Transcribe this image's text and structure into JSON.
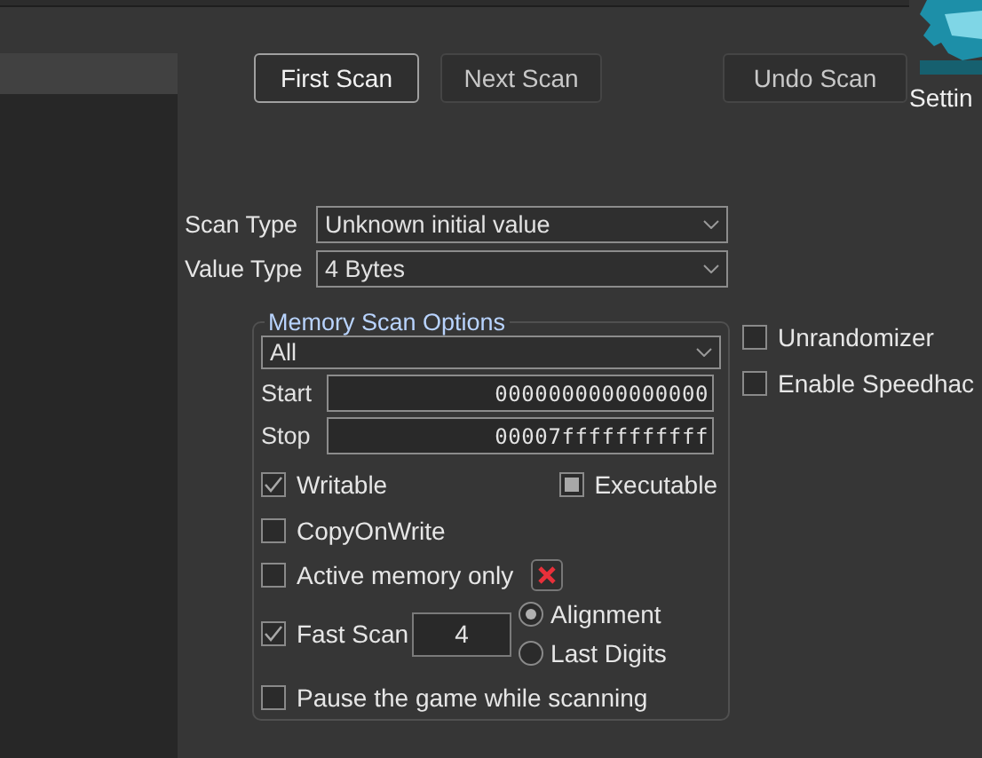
{
  "buttons": [
    {
      "label": "First Scan",
      "focused": true
    },
    {
      "label": "Next Scan",
      "focused": false
    },
    {
      "label": "Undo Scan",
      "focused": false
    }
  ],
  "settings_label": "Settin",
  "scan_type": {
    "label": "Scan Type",
    "value": "Unknown initial value"
  },
  "value_type": {
    "label": "Value Type",
    "value": "4 Bytes"
  },
  "memory_scan_options": {
    "title": "Memory Scan Options",
    "region": "All",
    "start": {
      "label": "Start",
      "value": "0000000000000000"
    },
    "stop": {
      "label": "Stop",
      "value": "00007fffffffffff"
    },
    "writable": {
      "label": "Writable",
      "checked": true
    },
    "executable": {
      "label": "Executable",
      "indeterminate": true
    },
    "copy_on_write": {
      "label": "CopyOnWrite",
      "checked": false
    },
    "active_memory_only": {
      "label": "Active memory only",
      "checked": false
    },
    "fast_scan": {
      "label": "Fast Scan",
      "checked": true,
      "value": "4"
    },
    "alignment_options": [
      {
        "label": "Alignment",
        "selected": true
      },
      {
        "label": "Last Digits",
        "selected": false
      }
    ],
    "pause": {
      "label": "Pause the game while scanning",
      "checked": false
    }
  },
  "side_options": [
    {
      "label": "Unrandomizer",
      "checked": false
    },
    {
      "label": "Enable Speedhac",
      "checked": false
    }
  ]
}
